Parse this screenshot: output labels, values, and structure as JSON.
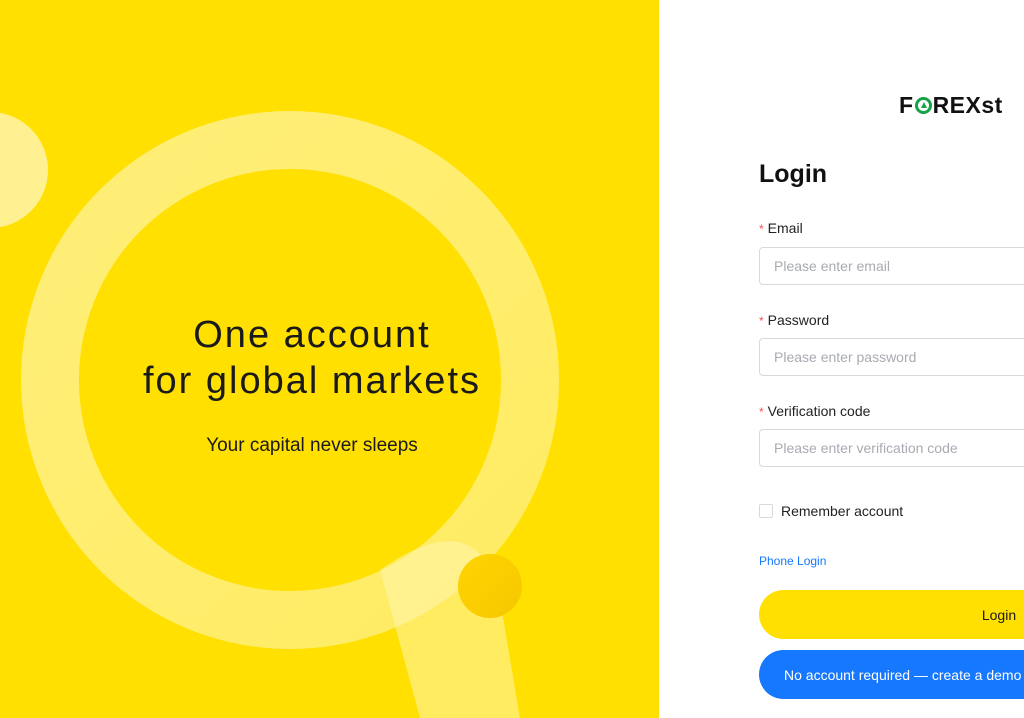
{
  "hero": {
    "headline_line1": "One account",
    "headline_line2": "for global markets",
    "tagline": "Your capital never sleeps",
    "background_color": "#ffe000"
  },
  "brand": {
    "logo_prefix": "F",
    "logo_suffix": "REXst",
    "logo_o_icon": "globe-arrow-icon"
  },
  "form": {
    "title": "Login",
    "required_marker": "*",
    "email": {
      "label": "Email",
      "placeholder": "Please enter email",
      "value": ""
    },
    "password": {
      "label": "Password",
      "placeholder": "Please enter password",
      "value": ""
    },
    "verification": {
      "label": "Verification code",
      "placeholder": "Please enter verification code",
      "value": ""
    },
    "remember_label": "Remember account",
    "remember_checked": false,
    "phone_login_link": "Phone Login",
    "login_button": "Login",
    "demo_button": "No account required — create a demo a"
  },
  "colors": {
    "accent_yellow": "#ffe000",
    "link_blue": "#1677ff",
    "required_red": "#ff4d4f",
    "logo_green": "#16a34a"
  }
}
